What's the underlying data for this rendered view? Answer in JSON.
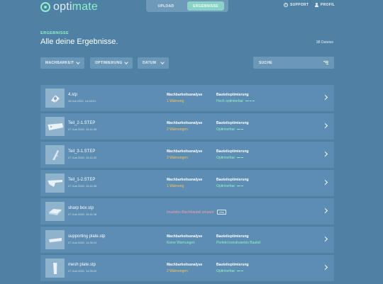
{
  "header": {
    "logo_text_main": "opti",
    "logo_text_accent": "mate",
    "tabs": [
      {
        "label": "UPLOAD"
      },
      {
        "label": "ERGEBNISSE"
      }
    ],
    "support_label": "SUPPORT",
    "profile_label": "PROFIL",
    "support_icon_glyph": "?"
  },
  "page": {
    "eyebrow": "ERGEBNISSE",
    "title": "Alle deine Ergebnisse.",
    "file_count": "98 Dateien"
  },
  "filters": {
    "manufacturability": "MACHBARKEIT",
    "optimization": "OPTIMIERUNG",
    "date": "DATUM",
    "search_placeholder": "SUCHE"
  },
  "columns": {
    "analysis_label": "Machbarkeitsanalyse",
    "optimization_label": "Bauteiloptimierung"
  },
  "rows": [
    {
      "name": "4.stp",
      "date": "28 Juli 2022, 14:34:01",
      "analysis": "1 Warnung",
      "analysis_status": "warn",
      "optimization": "Hoch optimierbar",
      "opt_level": 3
    },
    {
      "name": "Teil_2-1.STEP",
      "date": "27 Juni 2022, 11:41:25",
      "analysis": "2 Warnungen",
      "analysis_status": "warn",
      "optimization": "Optimierbar",
      "opt_level": 2
    },
    {
      "name": "Teil_3-1.STEP",
      "date": "27 Juni 2022, 11:41:22",
      "analysis": "3 Warnungen",
      "analysis_status": "warn",
      "optimization": "Optimierbar",
      "opt_level": 2
    },
    {
      "name": "Teil_1-2.STEP",
      "date": "27 Juni 2022, 11:41:28",
      "analysis": "1 Warnung",
      "analysis_status": "warn",
      "optimization": "Optimierbar",
      "opt_level": 2
    },
    {
      "name": "sharp box.stp",
      "date": "27 Juni 2022, 11:41:16",
      "invalid_text": "Invalides Blechbauteil erkannt",
      "info_badge": "Info"
    },
    {
      "name": "supporting plate.stp",
      "date": "27 Juni 2022, 11:39:24",
      "analysis": "Keine Warnungen",
      "analysis_status": "ok",
      "optimization": "Perfekt konstruiertes Bauteil",
      "opt_level": 0
    },
    {
      "name": "mesh plate.stp",
      "date": "27 Juni 2022, 11:39:22",
      "analysis": "2 Warnungen",
      "analysis_status": "warn",
      "optimization": "Optimierbar",
      "opt_level": 2
    }
  ],
  "colors": {
    "background": "#4f81a5",
    "accent": "#8ff0c8",
    "warning": "#f6c45a",
    "error": "#f4a0a7"
  }
}
